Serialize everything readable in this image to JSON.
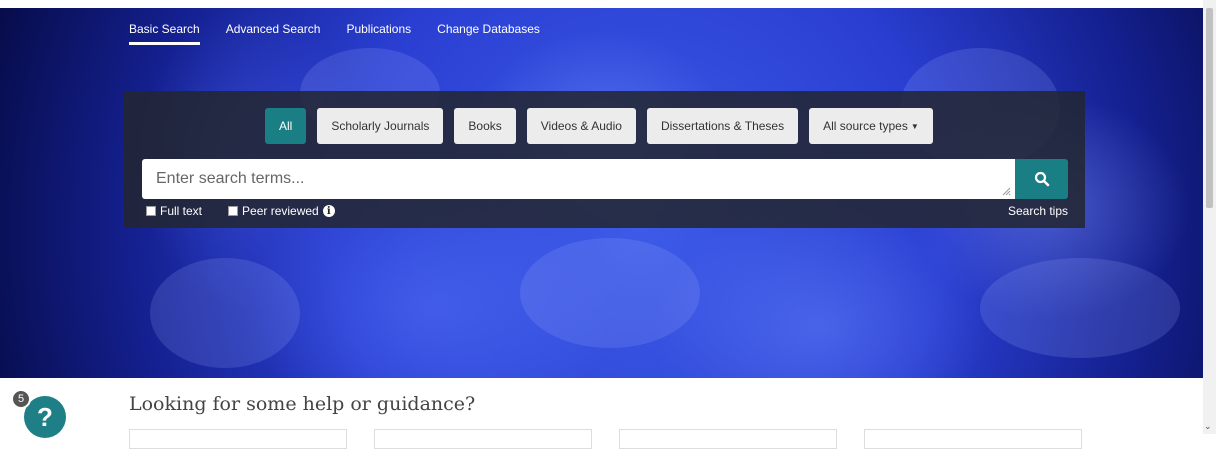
{
  "nav": {
    "items": [
      {
        "label": "Basic Search",
        "active": true
      },
      {
        "label": "Advanced Search"
      },
      {
        "label": "Publications"
      },
      {
        "label": "Change Databases"
      }
    ]
  },
  "source_types": {
    "chips": [
      "All",
      "Scholarly Journals",
      "Books",
      "Videos & Audio",
      "Dissertations & Theses"
    ],
    "dropdown_label": "All source types",
    "active": "All"
  },
  "search": {
    "placeholder": "Enter search terms...",
    "value": ""
  },
  "options": {
    "full_text": {
      "label": "Full text",
      "checked": false
    },
    "peer_reviewed": {
      "label": "Peer reviewed",
      "checked": false
    }
  },
  "search_tips": "Search tips",
  "help": {
    "heading": "Looking for some help or guidance?",
    "badge_count": "5",
    "fab_label": "?"
  },
  "colors": {
    "accent": "#1a7e85",
    "panel": "#232630",
    "hero": "#2a3fd2"
  },
  "icons": {
    "search_button": "search-icon",
    "info": "info-icon",
    "help": "help-icon"
  }
}
